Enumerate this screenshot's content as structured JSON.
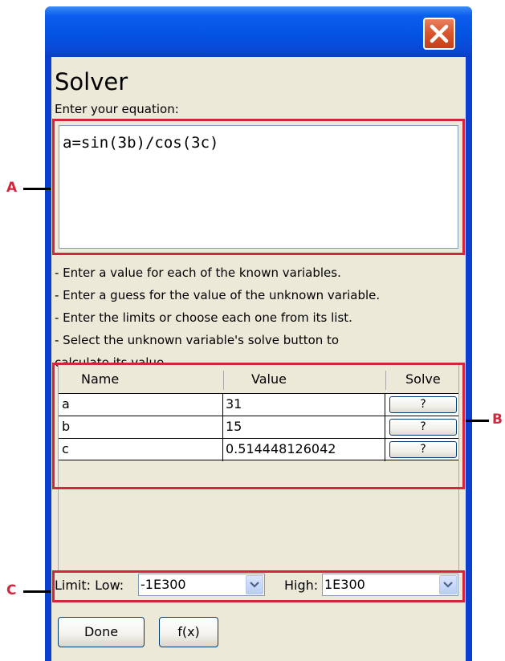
{
  "dialog": {
    "title": "Solver",
    "prompt": "Enter your equation:",
    "equation": "a=sin(3b)/cos(3c)",
    "instructions": [
      "- Enter a value for each of the known variables.",
      "- Enter a guess for the value of the unknown variable.",
      "- Enter the limits or choose each one from its list.",
      "- Select the unknown variable's solve button to",
      "calculate its value."
    ]
  },
  "table": {
    "headers": {
      "name": "Name",
      "value": "Value",
      "solve": "Solve"
    },
    "rows": [
      {
        "name": "a",
        "value": "31",
        "button": "?"
      },
      {
        "name": "b",
        "value": "15",
        "button": "?"
      },
      {
        "name": "c",
        "value": "0.514448126042",
        "button": "?"
      }
    ]
  },
  "limits": {
    "label": "Limit: Low:",
    "low": "-1E300",
    "high_label": "High:",
    "high": "1E300"
  },
  "buttons": {
    "done": "Done",
    "fx": "f(x)"
  },
  "callouts": {
    "a": "A",
    "b": "B",
    "c": "C"
  },
  "colors": {
    "callout": "#d3263d",
    "titlebar": "#0453e3",
    "close": "#d8542c"
  },
  "icons": {
    "close": "close-icon",
    "dropdown": "chevron-down-icon"
  }
}
